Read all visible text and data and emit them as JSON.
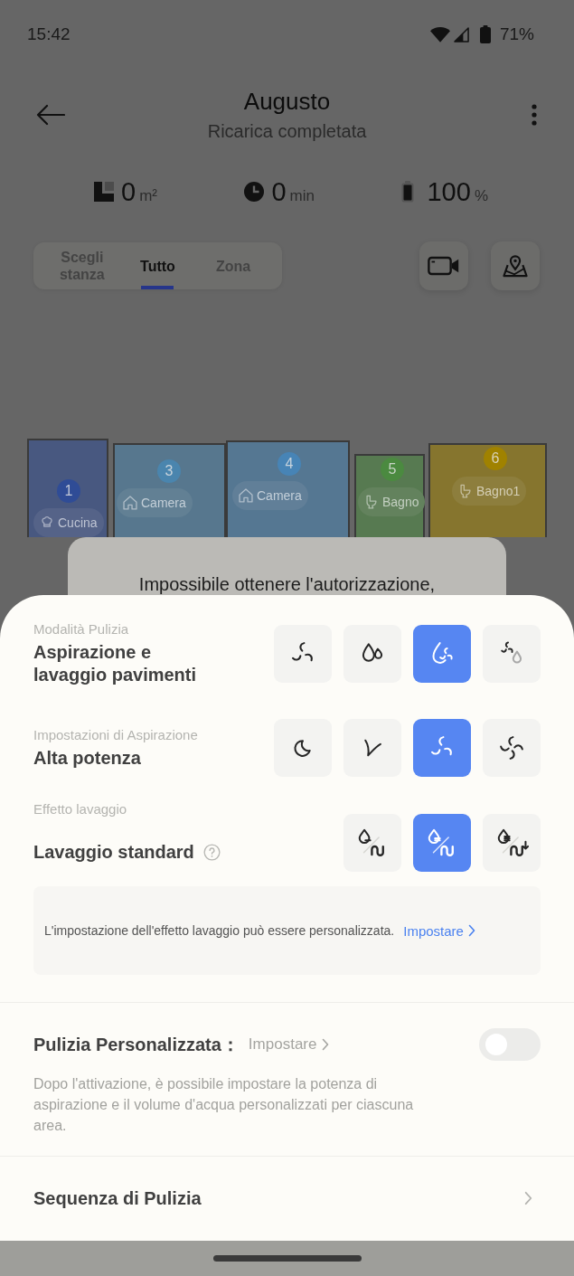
{
  "status_bar": {
    "time": "15:42",
    "battery": "71%"
  },
  "header": {
    "title": "Augusto",
    "subtitle": "Ricarica completata"
  },
  "stats": [
    {
      "kind": "area",
      "value": "0",
      "unit": "m²"
    },
    {
      "kind": "duration",
      "value": "0",
      "unit": "min"
    },
    {
      "kind": "battery",
      "value": "100",
      "unit": "%"
    }
  ],
  "tabs": [
    {
      "label": "Scegli stanza",
      "selected": false
    },
    {
      "label": "Tutto",
      "selected": true
    },
    {
      "label": "Zona",
      "selected": false
    }
  ],
  "tool_buttons": [
    {
      "kind": "camera"
    },
    {
      "kind": "map"
    }
  ],
  "map": {
    "rooms": [
      {
        "number": "1",
        "label": "Cucina",
        "kind": "kitchen",
        "color": "#2f4c96"
      },
      {
        "number": "3",
        "label": "Camera",
        "kind": "bedroom",
        "color": "#4a85ae"
      },
      {
        "number": "4",
        "label": "Camera",
        "kind": "bedroom",
        "color": "#4784b6"
      },
      {
        "number": "5",
        "label": "Bagno",
        "kind": "bathroom",
        "color": "#4b8a40"
      },
      {
        "number": "6",
        "label": "Bagno1",
        "kind": "bathroom",
        "color": "#a08200"
      }
    ]
  },
  "dialog": {
    "message": "Impossibile ottenere l'autorizzazione,"
  },
  "sheet": {
    "sections": [
      {
        "label": "Modalità Pulizia",
        "value": "Aspirazione e lavaggio pavimenti",
        "help": false,
        "options": [
          {
            "kind": "vacuum",
            "selected": false
          },
          {
            "kind": "mop",
            "selected": false
          },
          {
            "kind": "vacuum_mop",
            "selected": true
          },
          {
            "kind": "sequence",
            "selected": false
          }
        ]
      },
      {
        "label": "Impostazioni di Aspirazione",
        "value": "Alta potenza",
        "help": false,
        "options": [
          {
            "kind": "quiet",
            "selected": false
          },
          {
            "kind": "standard",
            "selected": false
          },
          {
            "kind": "strong",
            "selected": true
          },
          {
            "kind": "max",
            "selected": false
          }
        ]
      },
      {
        "label": "Effetto lavaggio",
        "value": "Lavaggio standard",
        "help": true,
        "options": [
          {
            "kind": "low",
            "selected": false
          },
          {
            "kind": "medium",
            "selected": true
          },
          {
            "kind": "high",
            "selected": false
          }
        ]
      }
    ],
    "info": {
      "text": "L'impostazione dell'effetto lavaggio può essere personalizzata.",
      "link": "Impostare"
    },
    "custom_cleaning": {
      "title": "Pulizia Personalizzata：",
      "link": {
        "label": "Impostare",
        "disabled": true
      },
      "on": false,
      "description": "Dopo l'attivazione, è possibile impostare la potenza di aspirazione e il volume d'acqua personalizzati per ciascuna area."
    },
    "sequence": {
      "title": "Sequenza di Pulizia"
    }
  }
}
